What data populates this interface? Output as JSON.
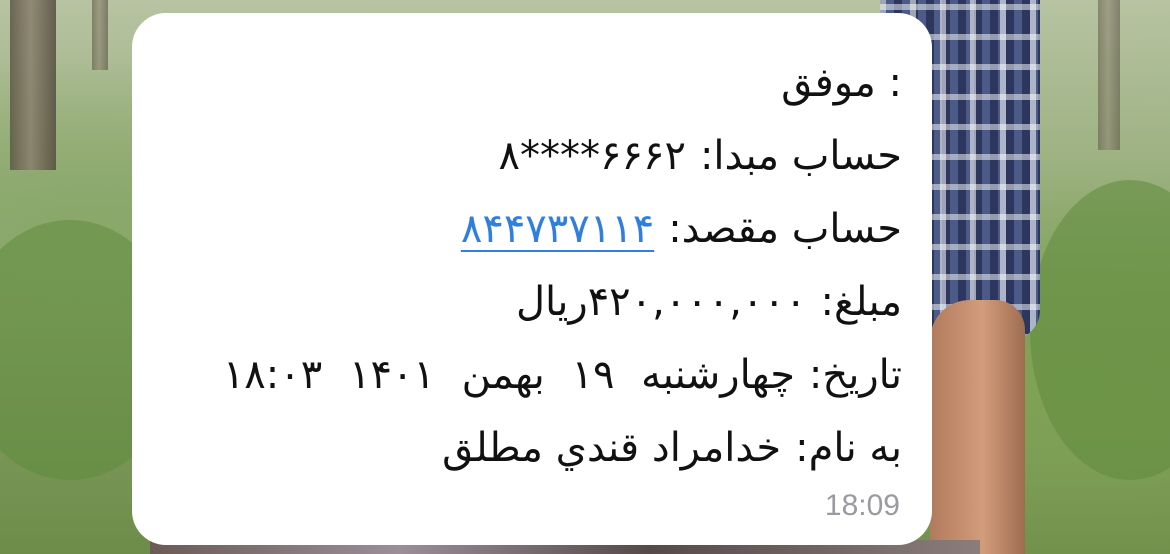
{
  "message": {
    "status_line": ": موفق",
    "lines": [
      {
        "label": "حساب مبدا:",
        "value": "۶۶۶۲****۸"
      },
      {
        "label": "حساب مقصد:",
        "value": "۸۴۴۷۳۷۱۱۴"
      },
      {
        "label": "مبلغ:",
        "value": "۴۲۰,۰۰۰,۰۰۰ریال"
      },
      {
        "label": "تاریخ:",
        "value": "چهارشنبه ۱۹ بهمن ۱۴۰۱ ۱۸:۰۳"
      },
      {
        "label": "به نام:",
        "value": "خدامراد قندي مطلق"
      }
    ],
    "timestamp": "18:09"
  },
  "colors": {
    "link": "#2f7fe0",
    "bubble": "#ffffff",
    "timestamp": "#9a9aa0",
    "text": "#111111"
  }
}
